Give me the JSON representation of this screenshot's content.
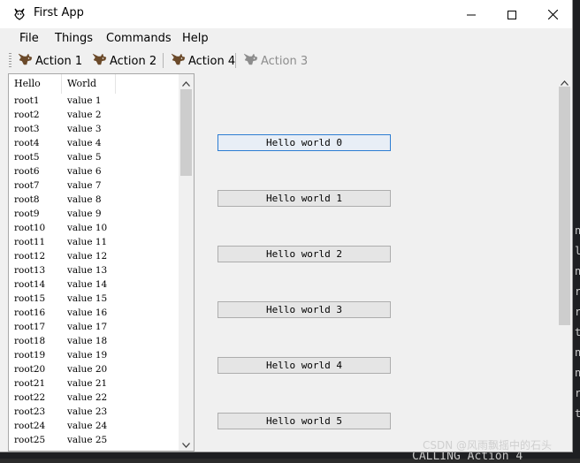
{
  "window": {
    "title": "First App",
    "icon": "gnu-icon"
  },
  "menu": [
    {
      "label": "File"
    },
    {
      "label": "Things"
    },
    {
      "label": "Commands"
    },
    {
      "label": "Help"
    }
  ],
  "toolbar": [
    {
      "label": "Action 1",
      "enabled": true
    },
    {
      "label": "Action 2",
      "enabled": true
    },
    {
      "label": "Action 4",
      "enabled": true
    },
    {
      "label": "Action 3",
      "enabled": false
    }
  ],
  "tree": {
    "columns": [
      "Hello",
      "World"
    ],
    "rows": [
      [
        "root1",
        "value 1"
      ],
      [
        "root2",
        "value 2"
      ],
      [
        "root3",
        "value 3"
      ],
      [
        "root4",
        "value 4"
      ],
      [
        "root5",
        "value 5"
      ],
      [
        "root6",
        "value 6"
      ],
      [
        "root7",
        "value 7"
      ],
      [
        "root8",
        "value 8"
      ],
      [
        "root9",
        "value 9"
      ],
      [
        "root10",
        "value 10"
      ],
      [
        "root11",
        "value 11"
      ],
      [
        "root12",
        "value 12"
      ],
      [
        "root13",
        "value 13"
      ],
      [
        "root14",
        "value 14"
      ],
      [
        "root15",
        "value 15"
      ],
      [
        "root16",
        "value 16"
      ],
      [
        "root17",
        "value 17"
      ],
      [
        "root18",
        "value 18"
      ],
      [
        "root19",
        "value 19"
      ],
      [
        "root20",
        "value 20"
      ],
      [
        "root21",
        "value 21"
      ],
      [
        "root22",
        "value 22"
      ],
      [
        "root23",
        "value 23"
      ],
      [
        "root24",
        "value 24"
      ],
      [
        "root25",
        "value 25"
      ]
    ]
  },
  "buttons": [
    {
      "label": "Hello world 0",
      "focused": true
    },
    {
      "label": "Hello world 1",
      "focused": false
    },
    {
      "label": "Hello world 2",
      "focused": false
    },
    {
      "label": "Hello world 3",
      "focused": false
    },
    {
      "label": "Hello world 4",
      "focused": false
    },
    {
      "label": "Hello world 5",
      "focused": false
    }
  ],
  "background": {
    "terminal_text": "CALLING Action 4",
    "right_glyphs": [
      "n",
      "l",
      "n",
      "r",
      "r",
      "t",
      "n",
      "n",
      "r",
      "t"
    ]
  },
  "watermark": "CSDN @风雨飘摇中的石头",
  "colors": {
    "focus_border": "#2d7dd2",
    "disabled_text": "#8d8d8d"
  }
}
